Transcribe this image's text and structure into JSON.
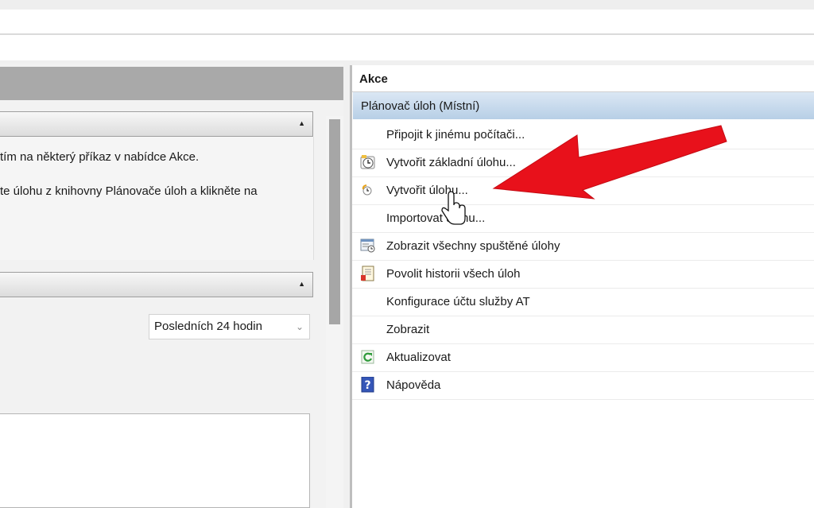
{
  "left": {
    "desc_line1": "tím na některý příkaz v nabídce Akce.",
    "desc_line2": "te úlohu z knihovny Plánovače úloh a klikněte na",
    "dropdown_value": "Posledních 24 hodin"
  },
  "actions": {
    "title": "Akce",
    "group": "Plánovač úloh (Místní)",
    "items": [
      {
        "label": "Připojit k jinému počítači...",
        "icon": "none"
      },
      {
        "label": "Vytvořit základní úlohu...",
        "icon": "clock-wizard-icon"
      },
      {
        "label": "Vytvořit úlohu...",
        "icon": "task-icon"
      },
      {
        "label": "Importovat úlohu...",
        "icon": "none"
      },
      {
        "label": "Zobrazit všechny spuštěné úlohy",
        "icon": "running-tasks-icon"
      },
      {
        "label": "Povolit historii všech úloh",
        "icon": "history-icon"
      },
      {
        "label": "Konfigurace účtu služby AT",
        "icon": "none"
      },
      {
        "label": "Zobrazit",
        "icon": "none"
      },
      {
        "label": "Aktualizovat",
        "icon": "refresh-icon"
      },
      {
        "label": "Nápověda",
        "icon": "help-icon"
      }
    ]
  },
  "colors": {
    "group_header": "#b7cfe6",
    "annotation_arrow": "#e8111b"
  }
}
